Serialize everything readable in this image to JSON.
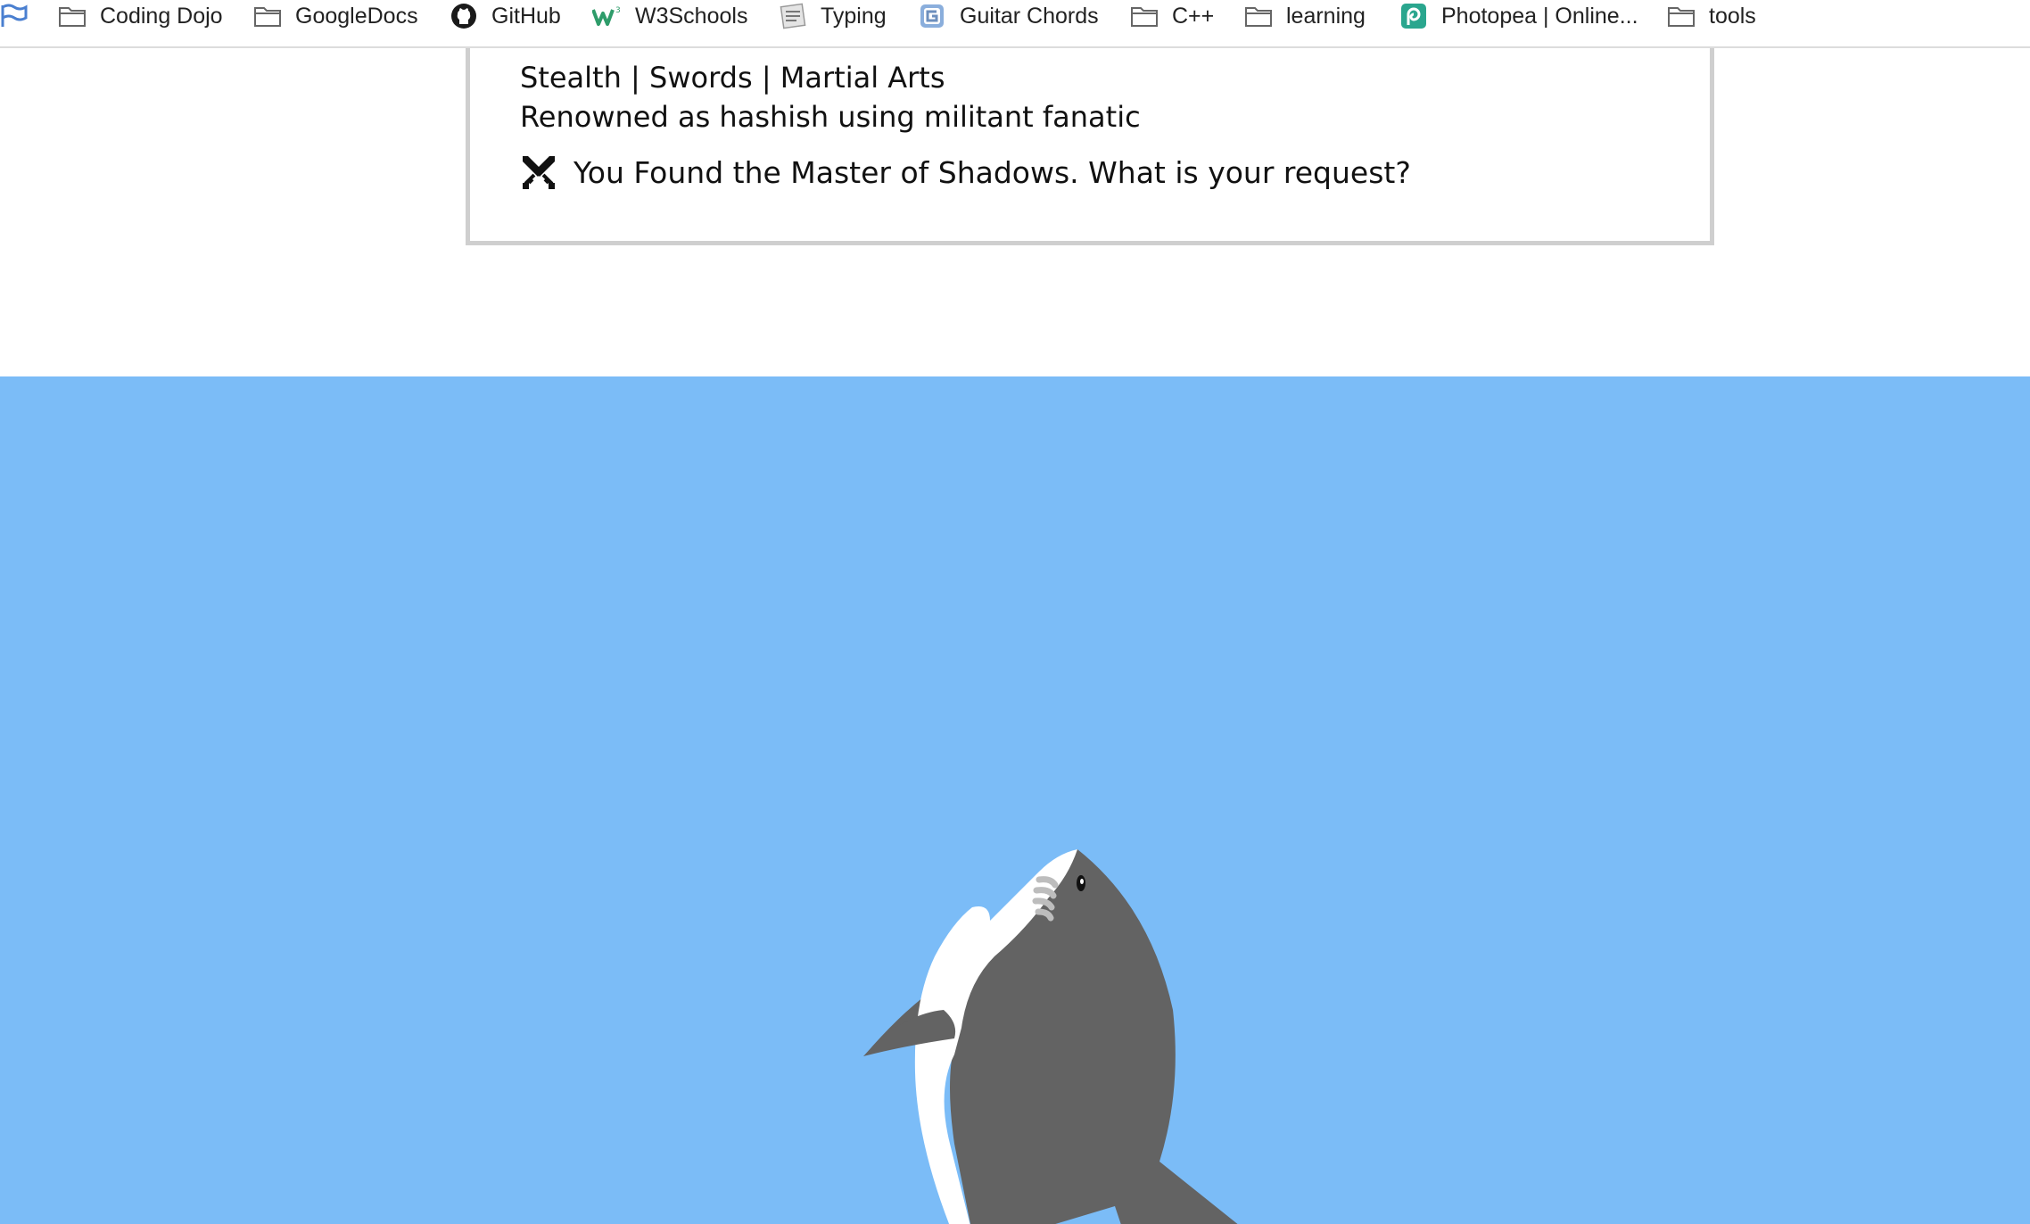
{
  "bookmarks_bar": {
    "items": [
      {
        "label": "Coding Dojo",
        "icon": "folder-icon"
      },
      {
        "label": "GoogleDocs",
        "icon": "folder-icon"
      },
      {
        "label": "GitHub",
        "icon": "github-icon"
      },
      {
        "label": "W3Schools",
        "icon": "w3schools-icon"
      },
      {
        "label": "Typing",
        "icon": "typing-icon"
      },
      {
        "label": "Guitar Chords",
        "icon": "guitar-chords-icon"
      },
      {
        "label": "C++",
        "icon": "folder-icon"
      },
      {
        "label": "learning",
        "icon": "folder-icon"
      },
      {
        "label": "Photopea | Online...",
        "icon": "photopea-icon"
      },
      {
        "label": "tools",
        "icon": "folder-icon"
      }
    ]
  },
  "profile_card": {
    "skills": "Stealth | Swords | Martial Arts",
    "reputation": "Renowned as hashish using militant fanatic",
    "request": "You Found the Master of Shadows. What is your request?",
    "request_icon": "crossed-swords-icon"
  },
  "colors": {
    "sky": "#7bbcf7",
    "shark_body": "#636363",
    "shark_belly": "#ffffff",
    "card_border": "#cfcfcf"
  }
}
